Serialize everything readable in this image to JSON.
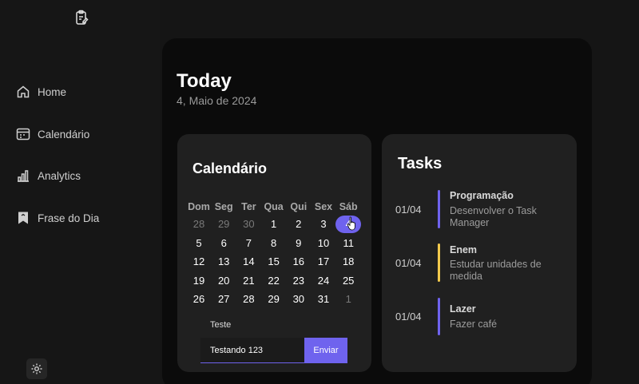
{
  "sidebar": {
    "items": [
      {
        "label": "Home",
        "icon": "home-icon"
      },
      {
        "label": "Calendário",
        "icon": "calendar-icon"
      },
      {
        "label": "Analytics",
        "icon": "analytics-icon"
      },
      {
        "label": "Frase do Dia",
        "icon": "bookmark-icon"
      }
    ]
  },
  "header": {
    "title": "Today",
    "date": "4, Maio de 2024"
  },
  "calendar": {
    "title": "Calendário",
    "weekdays": [
      "Dom",
      "Seg",
      "Ter",
      "Qua",
      "Qui",
      "Sex",
      "Sáb"
    ],
    "weeks": [
      [
        "28",
        "29",
        "30",
        "1",
        "2",
        "3",
        "4"
      ],
      [
        "5",
        "6",
        "7",
        "8",
        "9",
        "10",
        "11"
      ],
      [
        "12",
        "13",
        "14",
        "15",
        "16",
        "17",
        "18"
      ],
      [
        "19",
        "20",
        "21",
        "22",
        "23",
        "24",
        "25"
      ],
      [
        "26",
        "27",
        "28",
        "29",
        "30",
        "31",
        "1"
      ]
    ],
    "selected_day": "4",
    "form": {
      "label": "Teste",
      "input_value": "Testando 123",
      "button_label": "Enviar"
    }
  },
  "tasks": {
    "title": "Tasks",
    "items": [
      {
        "date": "01/04",
        "name": "Programação",
        "description": "Desenvolver o Task Manager",
        "color": "#6f63ee"
      },
      {
        "date": "01/04",
        "name": "Enem",
        "description": "Estudar unidades de medida",
        "color": "#f2c94c"
      },
      {
        "date": "01/04",
        "name": "Lazer",
        "description": "Fazer café",
        "color": "#6f63ee"
      }
    ]
  },
  "colors": {
    "accent": "#6f63ee",
    "background": "#151515",
    "card": "#202020"
  }
}
